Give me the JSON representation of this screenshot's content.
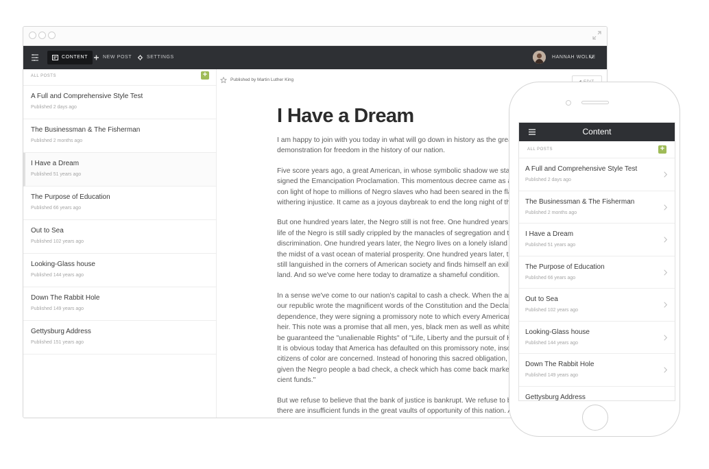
{
  "desktop": {
    "nav": {
      "content_label": "CONTENT",
      "new_post_label": "NEW POST",
      "settings_label": "SETTINGS",
      "user_name": "HANNAH WOLFE"
    },
    "list": {
      "header": "ALL POSTS",
      "add_label": "+"
    },
    "posts": [
      {
        "title": "A Full and Comprehensive Style Test",
        "meta": "Published 2 days ago"
      },
      {
        "title": "The Businessman & The Fisherman",
        "meta": "Published 2 months ago"
      },
      {
        "title": "I Have a Dream",
        "meta": "Published 51 years ago"
      },
      {
        "title": "The Purpose of Education",
        "meta": "Published 66 years ago"
      },
      {
        "title": "Out to Sea",
        "meta": "Published 102 years ago"
      },
      {
        "title": "Looking-Glass house",
        "meta": "Published 144 years ago"
      },
      {
        "title": "Down The Rabbit Hole",
        "meta": "Published 149 years ago"
      },
      {
        "title": "Gettysburg Address",
        "meta": "Published 151 years ago"
      }
    ],
    "article": {
      "byline": "Published  by  Martin Luther King",
      "edit_label": "EDIT",
      "title": "I Have a Dream",
      "lines": [
        [
          "I am happy to join with you today in what will go down in history as the great",
          "demonstration for freedom in the history of our nation."
        ],
        [
          "Five score years ago, a great American, in whose symbolic shadow we stand",
          "signed the Emancipation Proclamation. This momentous decree came as a g",
          "con light of hope to millions of Negro slaves who had been seared in the flar",
          "withering injustice. It came as a joyous daybreak to end the long night of the"
        ],
        [
          "But one hundred years later, the Negro still is not free. One hundred years l",
          "life of the Negro is still sadly crippled by the manacles of segregation and th",
          "discrimination. One hundred years later, the Negro lives on a lonely island o",
          "the midst of a vast ocean of material prosperity. One hundred years later, th",
          "still languished in the corners of American society and finds himself an exile",
          "land. And so we've come here today to dramatize a shameful condition."
        ],
        [
          "In a sense we've come to our nation's capital to cash a check. When the arch",
          "our republic wrote the magnificent words of the Constitution and the Declar",
          "dependence, they were signing a promissory note to which every American",
          "heir. This note was a promise that all men, yes, black men as well as white m",
          "be guaranteed the \"unalienable Rights\" of \"Life, Liberty and the pursuit of Ha",
          "It is obvious today that America has defaulted on this promissory note, insof",
          "citizens of color are concerned. Instead of honoring this sacred obligation, A",
          "given the Negro people a bad check, a check which has come back marked \"",
          "cient funds.\""
        ],
        [
          "But we refuse to believe that the bank of justice is bankrupt. We refuse to be",
          "there are insufficient funds in the great vaults of opportunity of this nation. A"
        ]
      ]
    }
  },
  "mobile": {
    "title": "Content",
    "list_header": "ALL POSTS",
    "add_label": "+",
    "posts": [
      {
        "title": "A Full and Comprehensive Style Test",
        "meta": "Published 2 days ago"
      },
      {
        "title": "The Businessman & The Fisherman",
        "meta": "Published 2 months ago"
      },
      {
        "title": "I Have a Dream",
        "meta": "Published 51 years ago"
      },
      {
        "title": "The Purpose of Education",
        "meta": "Published 66 years ago"
      },
      {
        "title": "Out to Sea",
        "meta": "Published 102 years ago"
      },
      {
        "title": "Looking-Glass house",
        "meta": "Published 144 years ago"
      },
      {
        "title": "Down The Rabbit Hole",
        "meta": "Published 149 years ago"
      },
      {
        "title": "Gettysburg Address",
        "meta": ""
      }
    ]
  },
  "colors": {
    "appbar": "#2e3034",
    "accent_green": "#9fbb58",
    "text_dark": "#3a3a3a",
    "text_muted": "#a5a5a5"
  },
  "icons": [
    "menu-icon",
    "content-icon",
    "plus-icon",
    "gear-icon",
    "chevron-down-icon",
    "star-icon",
    "pencil-icon",
    "chevron-right-icon",
    "expand-icon"
  ]
}
